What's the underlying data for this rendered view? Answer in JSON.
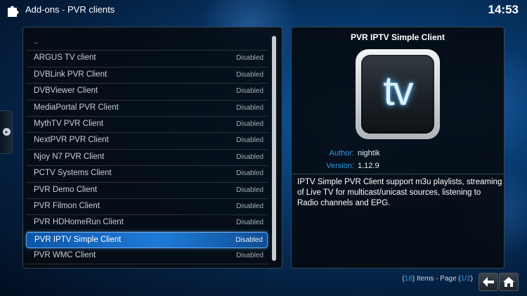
{
  "header": {
    "section": "Add-ons",
    "separator": "-",
    "title": "PVR clients",
    "icon": "addons-icon"
  },
  "clock": "14:53",
  "list": {
    "items": [
      {
        "label": "..",
        "status": ""
      },
      {
        "label": "ARGUS TV client",
        "status": "Disabled"
      },
      {
        "label": "DVBLink PVR Client",
        "status": "Disabled"
      },
      {
        "label": "DVBViewer Client",
        "status": "Disabled"
      },
      {
        "label": "MediaPortal PVR Client",
        "status": "Disabled"
      },
      {
        "label": "MythTV PVR Client",
        "status": "Disabled"
      },
      {
        "label": "NextPVR PVR Client",
        "status": "Disabled"
      },
      {
        "label": "Njoy N7 PVR Client",
        "status": "Disabled"
      },
      {
        "label": "PCTV Systems Client",
        "status": "Disabled"
      },
      {
        "label": "PVR Demo Client",
        "status": "Disabled"
      },
      {
        "label": "PVR Filmon Client",
        "status": "Disabled"
      },
      {
        "label": "PVR HDHomeRun Client",
        "status": "Disabled"
      },
      {
        "label": "PVR IPTV Simple Client",
        "status": "Disabled",
        "selected": true
      },
      {
        "label": "PVR WMC Client",
        "status": "Disabled"
      }
    ]
  },
  "info": {
    "title": "PVR IPTV Simple Client",
    "icon_text": "tv",
    "author_label": "Author:",
    "author": "nightik",
    "version_label": "Version:",
    "version": "1.12.9",
    "description": "IPTV Simple PVR Client support m3u playlists, streaming of Live TV for multicast/unicast sources, listening to Radio channels and EPG."
  },
  "footer": {
    "count_open": "(",
    "count": "18",
    "count_close": ") Items - Page (",
    "page": "1/2",
    "page_close": ")"
  },
  "colors": {
    "accent": "#2f98e8",
    "selected": "#1f7bd8"
  }
}
